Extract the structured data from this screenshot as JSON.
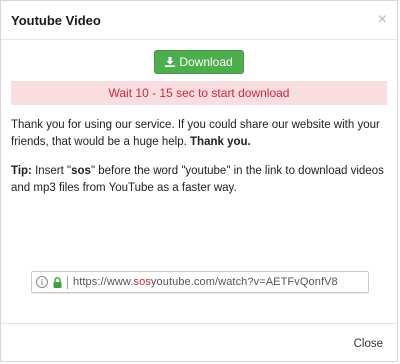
{
  "modal": {
    "title": "Youtube Video",
    "close_symbol": "×",
    "close_label": "Close"
  },
  "download": {
    "label": "Download",
    "icon": "download-icon",
    "color": "#4cae4c"
  },
  "notice": {
    "wait_text": "Wait 10 - 15 sec to start download",
    "bg_color": "#f8dde1",
    "text_color": "#d9253a"
  },
  "message": {
    "thanks_text": "Thank you for using our service. If you could share our website with your friends, that would be a huge help.",
    "thanks_bold": "Thank you."
  },
  "tip": {
    "label": "Tip:",
    "text_1": " Insert \"",
    "keyword": "sos",
    "text_2": "\" before the word \"youtube\" in the link to download videos and mp3 files from YouTube as a faster way."
  },
  "url_example": {
    "prefix": "https://www.",
    "highlight": "sos",
    "suffix": "youtube.com/watch?v=AETFvQonfV8"
  }
}
